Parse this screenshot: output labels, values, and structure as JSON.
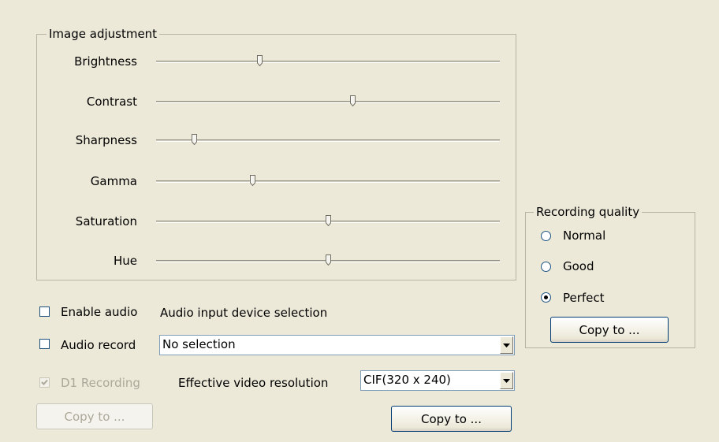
{
  "image_adjustment": {
    "title": "Image adjustment",
    "sliders": [
      {
        "label": "Brightness",
        "value": 30
      },
      {
        "label": "Contrast",
        "value": 57
      },
      {
        "label": "Sharpness",
        "value": 11
      },
      {
        "label": "Gamma",
        "value": 28
      },
      {
        "label": "Saturation",
        "value": 50
      },
      {
        "label": "Hue",
        "value": 50
      }
    ]
  },
  "audio": {
    "enable_audio_label": "Enable audio",
    "enable_audio_checked": false,
    "audio_record_label": "Audio record",
    "audio_record_checked": false,
    "device_selection_label": "Audio input device selection",
    "device_value": "No selection"
  },
  "d1_recording": {
    "label": "D1 Recording",
    "checked": true,
    "enabled": false
  },
  "resolution": {
    "label": "Effective video resolution",
    "value": "CIF(320 x 240)"
  },
  "buttons": {
    "copy_disabled": "Copy to ...",
    "copy_main": "Copy to ...",
    "copy_quality": "Copy to ..."
  },
  "recording_quality": {
    "title": "Recording quality",
    "options": [
      "Normal",
      "Good",
      "Perfect"
    ],
    "selected": "Perfect"
  }
}
